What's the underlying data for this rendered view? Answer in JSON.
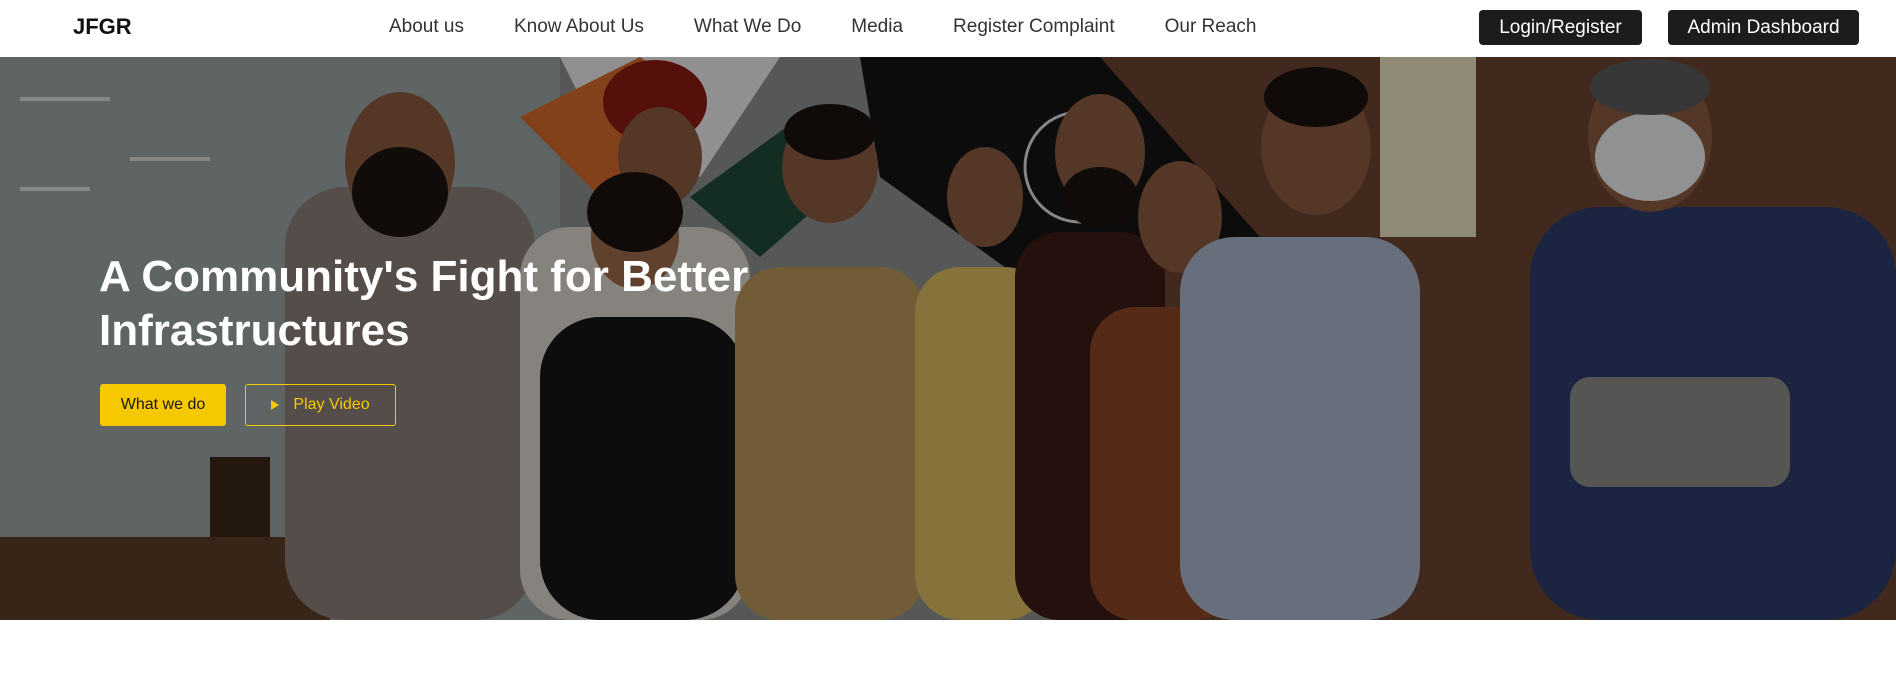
{
  "brand": "JFGR",
  "nav": {
    "links": [
      "About us",
      "Know About Us",
      "What We Do",
      "Media",
      "Register Complaint",
      "Our Reach"
    ],
    "login_label": "Login/Register",
    "admin_label": "Admin Dashboard"
  },
  "hero": {
    "title": "A Community's Fight for Better Infrastructures",
    "primary_cta": "What we do",
    "video_cta": "Play Video",
    "photo_icon": "group-photo",
    "accent_color": "#f5c800"
  },
  "colors": {
    "nav_button_bg": "#1c1c1c",
    "accent": "#f5c800"
  }
}
